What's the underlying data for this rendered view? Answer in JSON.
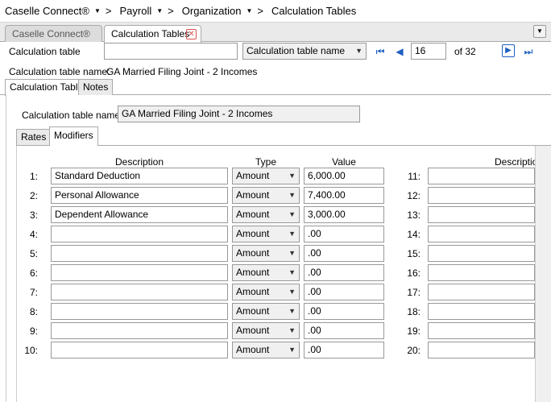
{
  "breadcrumb": {
    "items": [
      "Caselle Connect®",
      "Payroll",
      "Organization",
      "Calculation Tables"
    ],
    "separator": ">"
  },
  "tabs": {
    "home": "Caselle Connect®",
    "current": "Calculation Tables",
    "close_icon": "close-icon"
  },
  "lookup": {
    "label": "Calculation table",
    "search_value": "",
    "search_by": "Calculation table name",
    "record": "16",
    "of_label": "of 32"
  },
  "summary": {
    "label": "Calculation table name:",
    "value": "GA Married Filing Joint - 2 Incomes"
  },
  "detail_tabs": [
    "Calculation Table",
    "Notes"
  ],
  "form": {
    "name_label": "Calculation table name:",
    "name_value": "GA Married Filing Joint - 2 Incomes"
  },
  "inner_tabs": [
    "Rates",
    "Modifiers"
  ],
  "grid": {
    "headers": {
      "description": "Description",
      "type": "Type",
      "value": "Value",
      "description2": "Descriptio"
    },
    "rows": [
      {
        "num": "1:",
        "description": "Standard Deduction",
        "type": "Amount",
        "value": "6,000.00",
        "num2": "11:"
      },
      {
        "num": "2:",
        "description": "Personal Allowance",
        "type": "Amount",
        "value": "7,400.00",
        "num2": "12:"
      },
      {
        "num": "3:",
        "description": "Dependent Allowance",
        "type": "Amount",
        "value": "3,000.00",
        "num2": "13:"
      },
      {
        "num": "4:",
        "description": "",
        "type": "Amount",
        "value": ".00",
        "num2": "14:"
      },
      {
        "num": "5:",
        "description": "",
        "type": "Amount",
        "value": ".00",
        "num2": "15:"
      },
      {
        "num": "6:",
        "description": "",
        "type": "Amount",
        "value": ".00",
        "num2": "16:"
      },
      {
        "num": "7:",
        "description": "",
        "type": "Amount",
        "value": ".00",
        "num2": "17:"
      },
      {
        "num": "8:",
        "description": "",
        "type": "Amount",
        "value": ".00",
        "num2": "18:"
      },
      {
        "num": "9:",
        "description": "",
        "type": "Amount",
        "value": ".00",
        "num2": "19:"
      },
      {
        "num": "10:",
        "description": "",
        "type": "Amount",
        "value": ".00",
        "num2": "20:"
      }
    ]
  }
}
